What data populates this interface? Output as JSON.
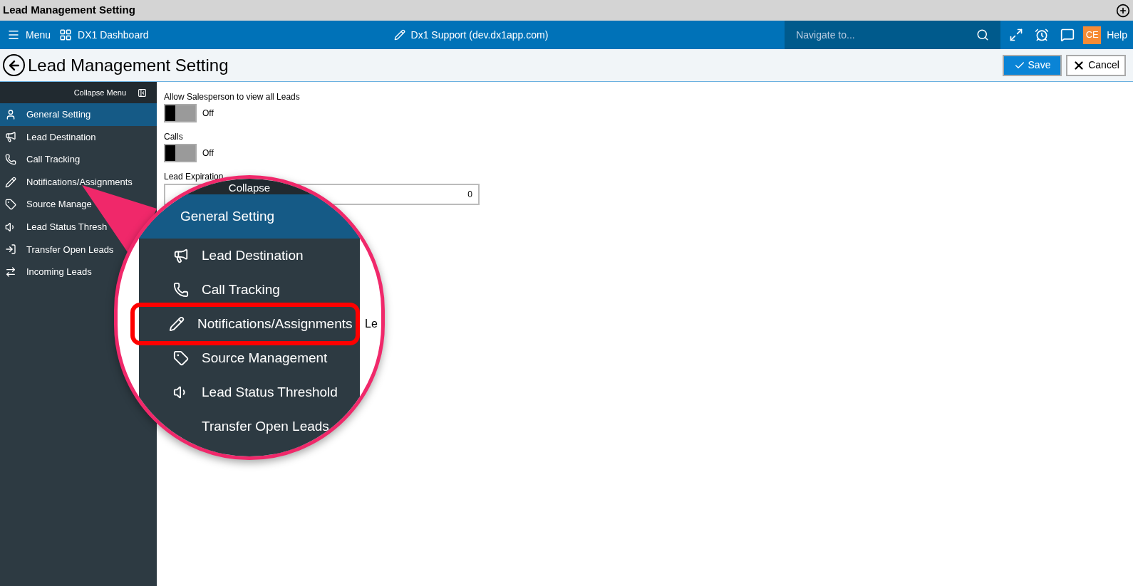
{
  "window": {
    "title": "Lead Management Setting"
  },
  "navbar": {
    "menu": "Menu",
    "dashboard": "DX1 Dashboard",
    "account": "Dx1 Support (dev.dx1app.com)",
    "search": {
      "placeholder": "Navigate to..."
    },
    "avatar": "CE",
    "help": "Help"
  },
  "page": {
    "title": "Lead Management Setting",
    "buttons": [
      {
        "kind": "save",
        "label": "Save"
      },
      {
        "kind": "cancel",
        "label": "Cancel"
      }
    ]
  },
  "sidebar": {
    "collapse": "Collapse Menu",
    "items": [
      {
        "label": "General Setting",
        "selected": true
      },
      {
        "label": "Lead Destination",
        "selected": false
      },
      {
        "label": "Call Tracking",
        "selected": false
      },
      {
        "label": "Notifications/Assignments",
        "selected": false
      },
      {
        "label": "Source Manage",
        "selected": false
      },
      {
        "label": "Lead Status Thresh",
        "selected": false
      },
      {
        "label": "Transfer Open Leads",
        "selected": false
      },
      {
        "label": "Incoming Leads",
        "selected": false
      }
    ]
  },
  "settings": [
    {
      "kind": "toggle",
      "label": "Allow Salesperson to view all Leads",
      "on": false,
      "state": "Off"
    },
    {
      "kind": "toggle",
      "label": "Calls",
      "on": false,
      "state": "Off"
    },
    {
      "kind": "number",
      "label": "Lead Expiration",
      "value": "0"
    }
  ],
  "magnifier": {
    "header": "Collapse",
    "side_label": "Le",
    "items": [
      {
        "label": "General Setting",
        "selected": true,
        "highlighted": false
      },
      {
        "label": "Lead Destination",
        "selected": false,
        "highlighted": false
      },
      {
        "label": "Call Tracking",
        "selected": false,
        "highlighted": false
      },
      {
        "label": "Notifications/Assignments",
        "selected": false,
        "highlighted": true
      },
      {
        "label": "Source Management",
        "selected": false,
        "highlighted": false
      },
      {
        "label": "Lead Status Threshold",
        "selected": false,
        "highlighted": false
      },
      {
        "label": "Transfer Open Leads",
        "selected": false,
        "highlighted": false
      }
    ]
  }
}
